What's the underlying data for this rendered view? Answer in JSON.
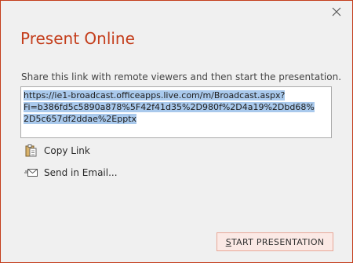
{
  "dialog": {
    "title": "Present Online",
    "instruction": "Share this link with remote viewers and then start the presentation.",
    "link_lines": [
      "https://ie1-broadcast.officeapps.live.com/m/Broadcast.aspx?",
      "Fi=b386fd5c5890a878%5F42f41d35%2D980f%2D4a19%2Dbd68%",
      "2D5c657df2ddae%2Epptx"
    ],
    "copy_link_label": "Copy Link",
    "send_email_label": "Send in Email...",
    "start_button": {
      "mnemonic": "S",
      "rest": "TART PRESENTATION"
    }
  },
  "icons": {
    "close": "close-icon",
    "copy": "clipboard-icon",
    "email": "email-icon"
  },
  "colors": {
    "accent": "#c43e1c",
    "background": "#f0f0f0",
    "selection": "#a9c9ec",
    "button_bg": "#fbe9e5",
    "button_border": "#e8a898"
  }
}
